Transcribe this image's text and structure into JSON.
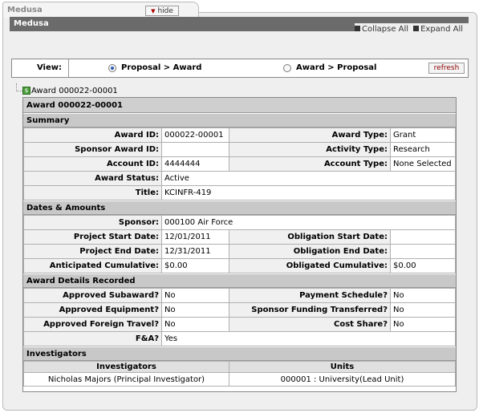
{
  "tab": {
    "title": "Medusa",
    "hide_label": "hide"
  },
  "panel": {
    "title": "Medusa",
    "collapse_all": "Collapse All",
    "expand_all": "Expand All"
  },
  "view": {
    "label": "View:",
    "option1": "Proposal > Award",
    "option2": "Award > Proposal",
    "selected": "Proposal > Award",
    "refresh": "refresh"
  },
  "tree": {
    "node_label": "Award 000022-00001"
  },
  "award": {
    "title": "Award 000022-00001",
    "summary": {
      "heading": "Summary",
      "award_id_label": "Award ID:",
      "award_id": "000022-00001",
      "award_type_label": "Award Type:",
      "award_type": "Grant",
      "sponsor_award_id_label": "Sponsor Award ID:",
      "sponsor_award_id": "",
      "activity_type_label": "Activity Type:",
      "activity_type": "Research",
      "account_id_label": "Account ID:",
      "account_id": "4444444",
      "account_type_label": "Account Type:",
      "account_type": "None Selected",
      "award_status_label": "Award Status:",
      "award_status": "Active",
      "title_label": "Title:",
      "title": "KCINFR-419"
    },
    "dates": {
      "heading": "Dates & Amounts",
      "sponsor_label": "Sponsor:",
      "sponsor": "000100 Air Force",
      "project_start_label": "Project Start Date:",
      "project_start": "12/01/2011",
      "obligation_start_label": "Obligation Start Date:",
      "obligation_start": "",
      "project_end_label": "Project End Date:",
      "project_end": "12/31/2011",
      "obligation_end_label": "Obligation End Date:",
      "obligation_end": "",
      "anticipated_label": "Anticipated Cumulative:",
      "anticipated": "$0.00",
      "obligated_label": "Obligated Cumulative:",
      "obligated": "$0.00"
    },
    "details": {
      "heading": "Award Details Recorded",
      "approved_subaward_label": "Approved Subaward?",
      "approved_subaward": "No",
      "payment_schedule_label": "Payment Schedule?",
      "payment_schedule": "No",
      "approved_equipment_label": "Approved Equipment?",
      "approved_equipment": "No",
      "sponsor_funding_label": "Sponsor Funding Transferred?",
      "sponsor_funding": "No",
      "approved_travel_label": "Approved Foreign Travel?",
      "approved_travel": "No",
      "cost_share_label": "Cost Share?",
      "cost_share": "No",
      "fa_label": "F&A?",
      "fa": "Yes"
    },
    "investigators": {
      "heading": "Investigators",
      "col_investigators": "Investigators",
      "col_units": "Units",
      "rows": [
        {
          "name": "Nicholas Majors (Principal Investigator)",
          "unit": "000001 : University(Lead Unit)"
        }
      ]
    }
  }
}
